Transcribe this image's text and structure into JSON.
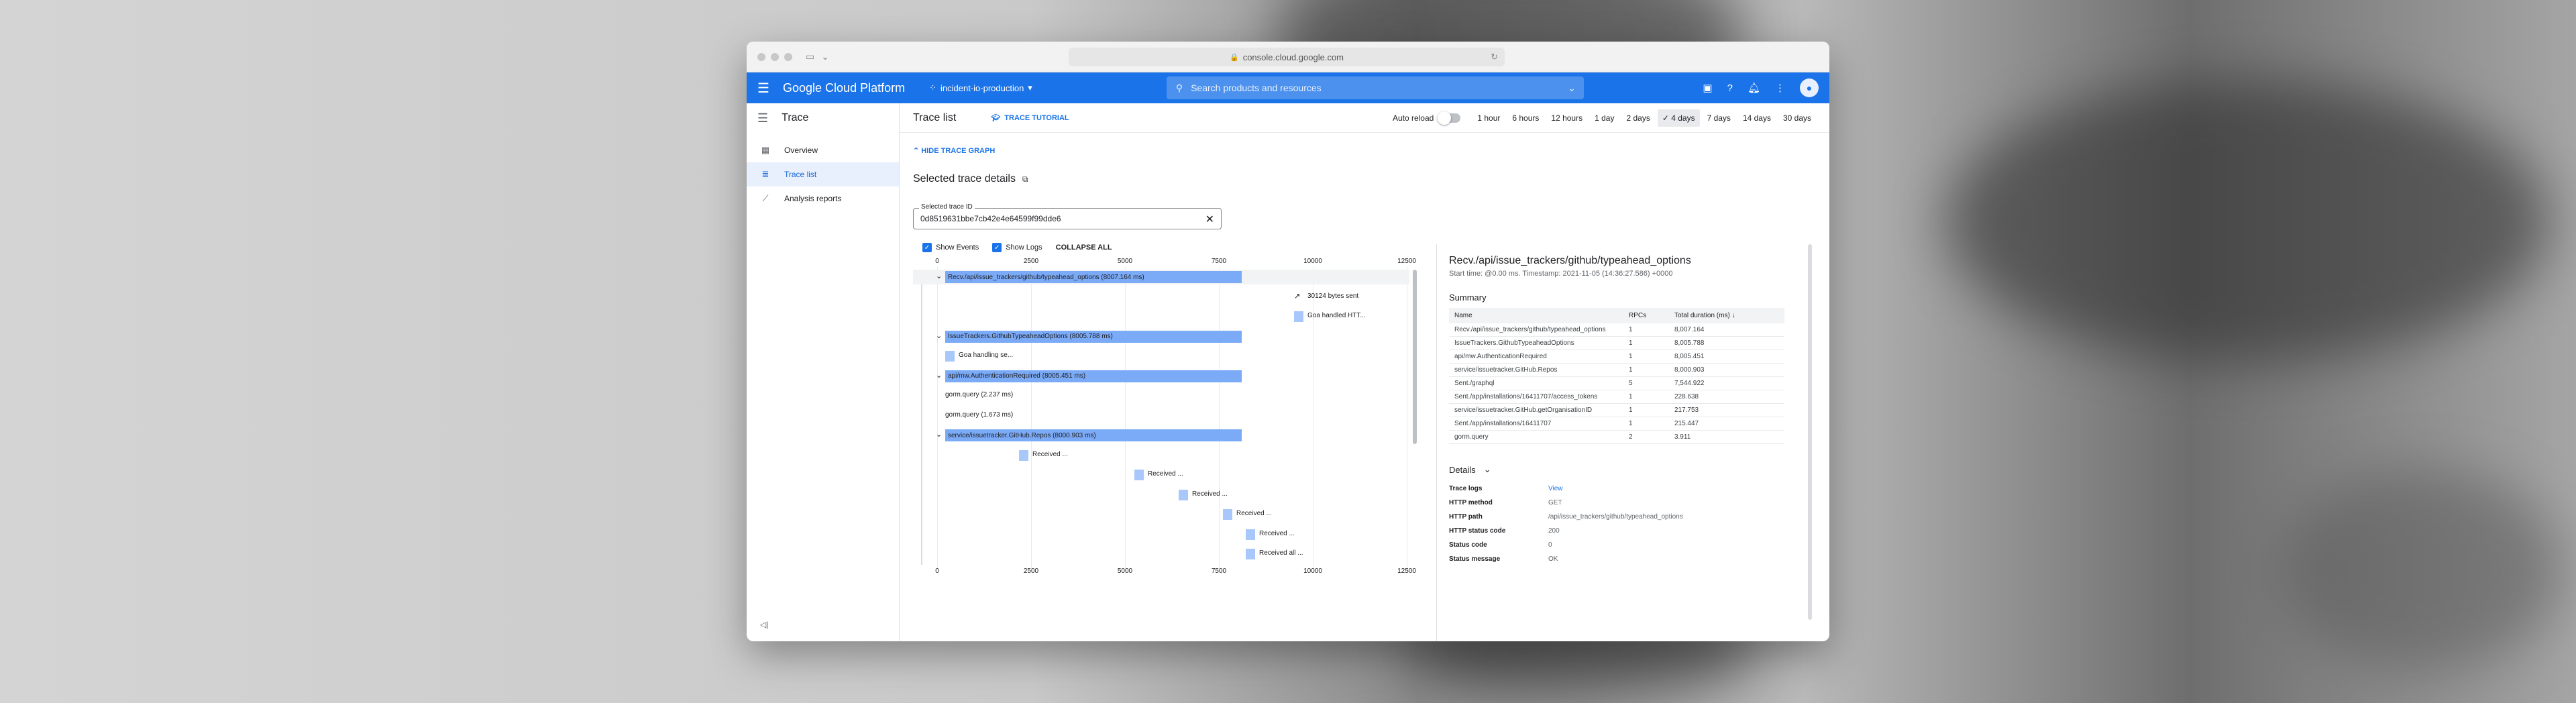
{
  "browser": {
    "url": "console.cloud.google.com"
  },
  "header": {
    "brand": "Google Cloud Platform",
    "project": "incident-io-production",
    "search_placeholder": "Search products and resources"
  },
  "sidebar": {
    "title": "Trace",
    "items": [
      {
        "label": "Overview",
        "icon": "dashboard-icon"
      },
      {
        "label": "Trace list",
        "icon": "list-icon",
        "active": true
      },
      {
        "label": "Analysis reports",
        "icon": "chart-icon"
      }
    ]
  },
  "toolbar": {
    "title": "Trace list",
    "tutorial": "TRACE TUTORIAL",
    "auto_reload": "Auto reload",
    "ranges": [
      "1 hour",
      "6 hours",
      "12 hours",
      "1 day",
      "2 days",
      "4 days",
      "7 days",
      "14 days",
      "30 days"
    ],
    "selected_range": "4 days"
  },
  "trace": {
    "hide_graph": "HIDE TRACE GRAPH",
    "section_title": "Selected trace details",
    "id_label": "Selected trace ID",
    "id_value": "0d8519631bbe7cb42e4e64599f99dde6",
    "show_events": "Show Events",
    "show_logs": "Show Logs",
    "collapse_all": "COLLAPSE ALL",
    "axis_ticks": [
      "0",
      "2500",
      "5000",
      "7500",
      "10000",
      "12500"
    ],
    "spans": [
      {
        "label": "Recv./api/issue_trackers/github/typeahead_options (8007.164 ms)"
      },
      {
        "label": "30124 bytes sent"
      },
      {
        "label": "Goa handled HTT..."
      },
      {
        "label": "IssueTrackers.GithubTypeaheadOptions (8005.788 ms)"
      },
      {
        "label": "Goa handling se..."
      },
      {
        "label": "api/mw.AuthenticationRequired (8005.451 ms)"
      },
      {
        "label": "gorm.query (2.237 ms)"
      },
      {
        "label": "gorm.query (1.673 ms)"
      },
      {
        "label": "service/issuetracker.GitHub.Repos (8000.903 ms)"
      },
      {
        "label": "Received ..."
      },
      {
        "label": "Received ..."
      },
      {
        "label": "Received ..."
      },
      {
        "label": "Received ..."
      },
      {
        "label": "Received ..."
      },
      {
        "label": "Received all ..."
      }
    ]
  },
  "detail": {
    "title": "Recv./api/issue_trackers/github/typeahead_options",
    "subtitle": "Start time: @0.00 ms. Timestamp: 2021-11-05 (14:36:27.586) +0000",
    "summary_title": "Summary",
    "columns": [
      "Name",
      "RPCs",
      "Total duration (ms)"
    ],
    "rows": [
      [
        "Recv./api/issue_trackers/github/typeahead_options",
        "1",
        "8,007.164"
      ],
      [
        "IssueTrackers.GithubTypeaheadOptions",
        "1",
        "8,005.788"
      ],
      [
        "api/mw.AuthenticationRequired",
        "1",
        "8,005.451"
      ],
      [
        "service/issuetracker.GitHub.Repos",
        "1",
        "8,000.903"
      ],
      [
        "Sent./graphql",
        "5",
        "7,544.922"
      ],
      [
        "Sent./app/installations/16411707/access_tokens",
        "1",
        "228.638"
      ],
      [
        "service/issuetracker.GitHub.getOrganisationID",
        "1",
        "217.753"
      ],
      [
        "Sent./app/installations/16411707",
        "1",
        "215.447"
      ],
      [
        "gorm.query",
        "2",
        "3.911"
      ]
    ],
    "details_title": "Details",
    "kv": [
      [
        "Trace logs",
        "View"
      ],
      [
        "HTTP method",
        "GET"
      ],
      [
        "HTTP path",
        "/api/issue_trackers/github/typeahead_options"
      ],
      [
        "HTTP status code",
        "200"
      ],
      [
        "Status code",
        "0"
      ],
      [
        "Status message",
        "OK"
      ]
    ]
  }
}
